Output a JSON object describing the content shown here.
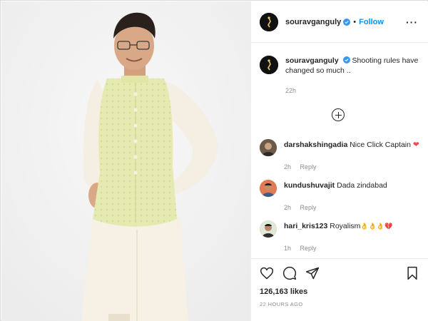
{
  "post": {
    "username": "souravganguly",
    "follow_label": "Follow",
    "separator": "•",
    "more_label": "···",
    "caption": "Shooting rules have changed so much ..",
    "caption_time": "22h",
    "likes": "126,163 likes",
    "posted_ago": "22 HOURS AGO"
  },
  "comments": [
    {
      "username": "darshakshingadia",
      "text": "Nice Click Captain",
      "emoji": "❤",
      "time": "2h",
      "reply": "Reply"
    },
    {
      "username": "kundushuvajit",
      "text": "Dada zindabad",
      "emoji": "",
      "time": "2h",
      "reply": "Reply"
    },
    {
      "username": "hari_kris123",
      "text": "Royalism",
      "emoji": "👌👌👌💔",
      "time": "1h",
      "reply": "Reply"
    }
  ],
  "colors": {
    "accent": "#0095f6",
    "jacket": "#e4eab0",
    "kurta": "#f6f1e4",
    "heart": "#ed4956"
  },
  "icons": [
    "verified-badge-icon",
    "more-options-icon",
    "load-more-comments-icon",
    "like-heart-icon",
    "comment-bubble-icon",
    "share-paper-plane-icon",
    "bookmark-icon"
  ]
}
